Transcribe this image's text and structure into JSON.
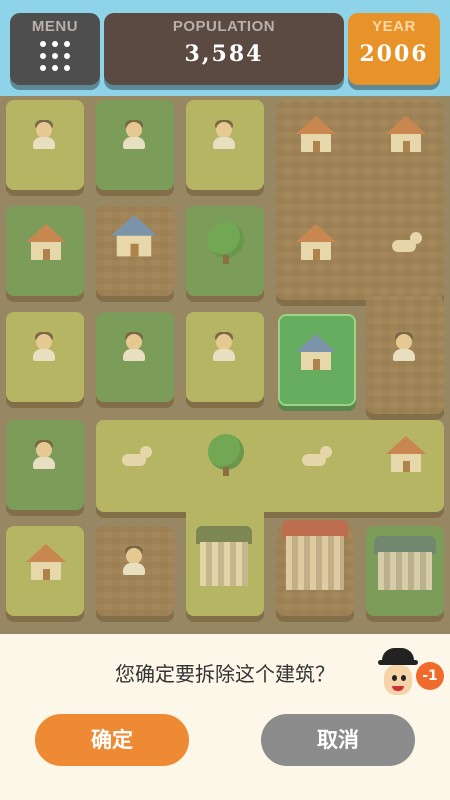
{
  "topbar": {
    "menu": {
      "label": "MENU",
      "icon": "grid-dots-icon"
    },
    "population": {
      "label": "POPULATION",
      "value": "3,584"
    },
    "year": {
      "label": "YEAR",
      "value": "2006"
    }
  },
  "board": {
    "sprites": [
      "person",
      "house",
      "tree",
      "dog",
      "townhouse",
      "mansion"
    ]
  },
  "dialog": {
    "question": "您确定要拆除这个建筑？",
    "penalty": "-1",
    "confirm_label": "确定",
    "cancel_label": "取消"
  },
  "colors": {
    "sky": "#8fd3e8",
    "confirm": "#ef8a34",
    "cancel": "#8c8c8c",
    "selected_tile": "#2fa552"
  }
}
